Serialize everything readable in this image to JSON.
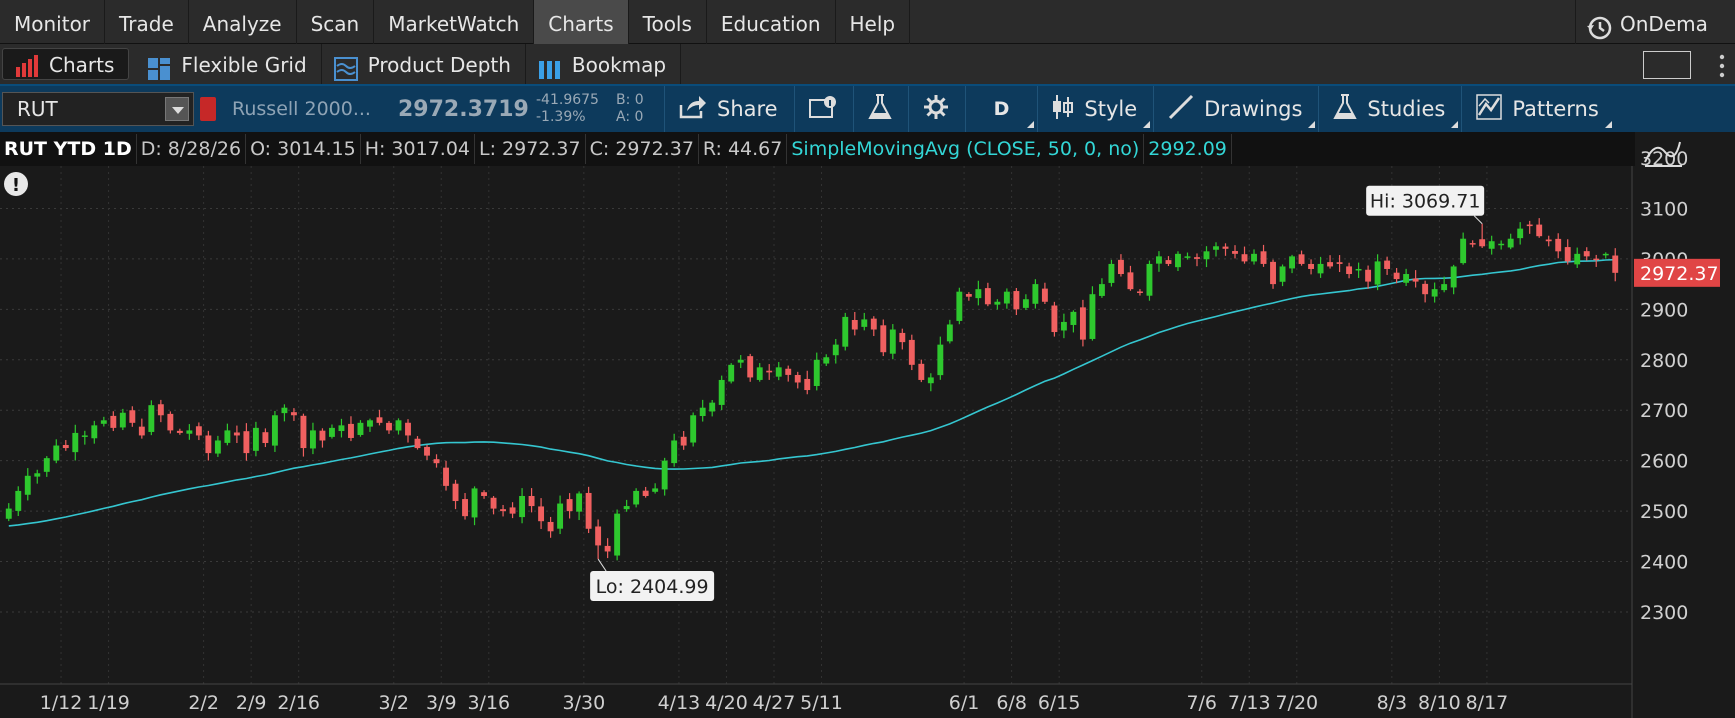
{
  "menu": {
    "items": [
      "Monitor",
      "Trade",
      "Analyze",
      "Scan",
      "MarketWatch",
      "Charts",
      "Tools",
      "Education",
      "Help"
    ],
    "active": "Charts",
    "ondemand_label": "OnDema"
  },
  "subtabs": {
    "items": [
      "Charts",
      "Flexible Grid",
      "Product Depth",
      "Bookmap"
    ]
  },
  "toolbar": {
    "symbol": "RUT",
    "description": "Russell 2000...",
    "last": "2972.3719",
    "net_change": "-41.9675",
    "pct_change": "-1.39%",
    "bid_size": "B: 0",
    "ask_size": "A: 0",
    "share_label": "Share",
    "period_label": "D",
    "style_label": "Style",
    "drawings_label": "Drawings",
    "studies_label": "Studies",
    "patterns_label": "Patterns"
  },
  "infobar": {
    "title": "RUT YTD 1D",
    "date": "D: 8/28/26",
    "open": "O: 3014.15",
    "high": "H: 3017.04",
    "low": "L: 2972.37",
    "close": "C: 2972.37",
    "range": "R: 44.67",
    "study": "SimpleMovingAvg (CLOSE, 50, 0, no)",
    "study_value": "2992.09"
  },
  "colors": {
    "up": "#2ec82e",
    "down": "#f06060",
    "sma": "#35c6d0",
    "background": "#1a1a1a",
    "price_tag": "#e04545"
  },
  "chart_data": {
    "type": "candlestick",
    "symbol": "RUT",
    "timeframe": "YTD 1D",
    "ylim": [
      2300,
      3200
    ],
    "y_ticks": [
      2300,
      2400,
      2500,
      2600,
      2700,
      2800,
      2900,
      3000,
      3100,
      3200
    ],
    "x_tick_labels": [
      "1/12",
      "1/19",
      "2/2",
      "2/9",
      "2/16",
      "3/2",
      "3/9",
      "3/16",
      "3/30",
      "4/13",
      "4/20",
      "4/27",
      "5/11",
      "6/1",
      "6/8",
      "6/15",
      "7/6",
      "7/13",
      "7/20",
      "8/3",
      "8/10",
      "8/17"
    ],
    "x_tick_positions": [
      6,
      11,
      21,
      26,
      31,
      41,
      46,
      51,
      61,
      71,
      76,
      81,
      86,
      101,
      106,
      111,
      126,
      131,
      136,
      146,
      151,
      156
    ],
    "closes": [
      2505,
      2540,
      2570,
      2575,
      2605,
      2630,
      2625,
      2655,
      2650,
      2670,
      2680,
      2665,
      2695,
      2675,
      2650,
      2710,
      2690,
      2660,
      2655,
      2660,
      2650,
      2615,
      2640,
      2660,
      2650,
      2615,
      2665,
      2635,
      2690,
      2705,
      2690,
      2625,
      2660,
      2640,
      2665,
      2670,
      2645,
      2675,
      2680,
      2675,
      2660,
      2680,
      2650,
      2625,
      2610,
      2595,
      2550,
      2520,
      2490,
      2545,
      2530,
      2505,
      2500,
      2495,
      2530,
      2510,
      2480,
      2460,
      2515,
      2500,
      2535,
      2465,
      2432,
      2420,
      2495,
      2510,
      2540,
      2530,
      2545,
      2600,
      2640,
      2630,
      2690,
      2705,
      2715,
      2760,
      2790,
      2800,
      2765,
      2785,
      2775,
      2785,
      2770,
      2755,
      2740,
      2800,
      2805,
      2830,
      2885,
      2860,
      2880,
      2860,
      2815,
      2860,
      2835,
      2790,
      2760,
      2765,
      2830,
      2870,
      2935,
      2925,
      2940,
      2910,
      2915,
      2935,
      2900,
      2920,
      2950,
      2915,
      2855,
      2875,
      2895,
      2840,
      2930,
      2950,
      2990,
      2970,
      2940,
      2935,
      2990,
      3005,
      2990,
      3010,
      3005,
      3000,
      3015,
      3025,
      3020,
      3010,
      2995,
      3010,
      2990,
      2950,
      2985,
      3005,
      2990,
      2980,
      2990,
      2985,
      2990,
      2970,
      2980,
      2955,
      2995,
      2980,
      2960,
      2970,
      2955,
      2930,
      2940,
      2950,
      2985,
      3040,
      3030,
      3025,
      3035,
      3030,
      3040,
      3060,
      3065,
      3045,
      3035,
      3015,
      2995,
      3010,
      3005,
      3000,
      3010,
      2972.37
    ],
    "sma50": {
      "name": "SimpleMovingAvg (CLOSE, 50, 0, no)",
      "last": 2992.09
    },
    "annotations": {
      "high": "Hi: 3069.71",
      "low": "Lo: 2404.99"
    },
    "last_price_tag": "2972.37"
  }
}
